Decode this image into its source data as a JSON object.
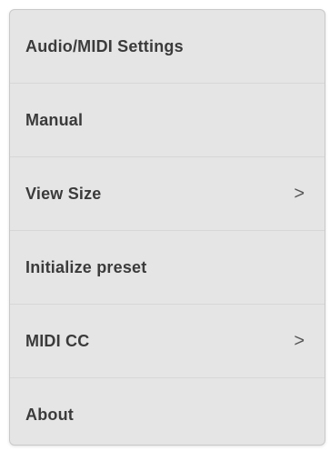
{
  "menu": {
    "items": [
      {
        "label": "Audio/MIDI Settings",
        "has_submenu": false
      },
      {
        "label": "Manual",
        "has_submenu": false
      },
      {
        "label": "View Size",
        "has_submenu": true,
        "submenu_glyph": ">"
      },
      {
        "label": "Initialize preset",
        "has_submenu": false
      },
      {
        "label": "MIDI CC",
        "has_submenu": true,
        "submenu_glyph": ">"
      },
      {
        "label": "About",
        "has_submenu": false
      }
    ]
  },
  "colors": {
    "menu_background": "#e5e5e5",
    "text": "#3b3b3b",
    "divider": "#d7d7d7"
  },
  "icons": {
    "submenu": "chevron-right-icon"
  }
}
